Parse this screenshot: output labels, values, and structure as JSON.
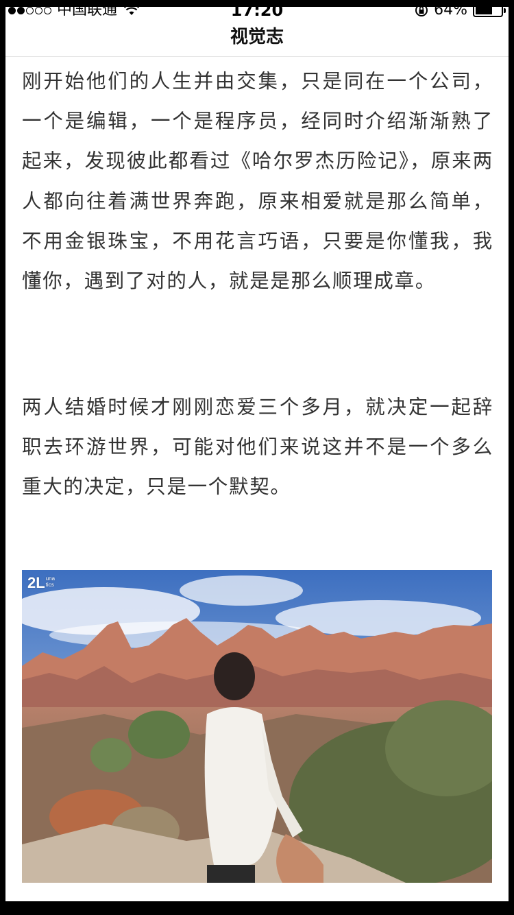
{
  "status_bar": {
    "carrier": "中国联通",
    "time": "17:20",
    "battery": "64%"
  },
  "nav": {
    "title": "视觉志"
  },
  "article": {
    "paragraphs": [
      "刚开始他们的人生并由交集，只是同在一个公司，一个是编辑，一个是程序员，经同时介绍渐渐熟了起来，发现彼此都看过《哈尔罗杰历险记》，原来两人都向往着满世界奔跑，原来相爱就是那么简单，不用金银珠宝，不用花言巧语，只要是你懂我，我懂你，遇到了对的人，就是是那么顺理成章。",
      "两人结婚时候才刚刚恋爱三个多月，就决定一起辞职去环游世界，可能对他们来说这并不是一个多么重大的决定，只是一个默契。"
    ],
    "photo": {
      "watermark_main": "2L",
      "watermark_top": "una",
      "watermark_bottom": "tics"
    }
  },
  "icons": {
    "wifi": "wifi-icon",
    "lock": "rotation-lock-icon",
    "battery": "battery-icon"
  }
}
